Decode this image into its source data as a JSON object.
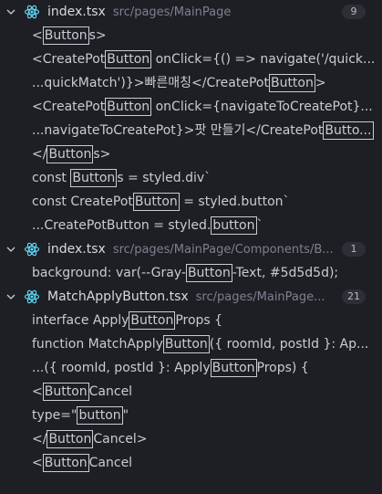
{
  "groups": [
    {
      "file": "index.tsx",
      "path": "src/pages/MainPage",
      "count": "9",
      "matches": [
        [
          "<",
          "Button",
          "s>"
        ],
        [
          "<CreatePot",
          "Button",
          " onClick={() => navigate('/quick..."
        ],
        [
          "...quickMatch')}>빠른매칭</CreatePot",
          "Button",
          ">"
        ],
        [
          "<CreatePot",
          "Button",
          " onClick={navigateToCreatePot}..."
        ],
        [
          "...navigateToCreatePot}>팟 만들기</CreatePot",
          "Butto...",
          ""
        ],
        [
          "</",
          "Button",
          "s>"
        ],
        [
          "const ",
          "Button",
          "s = styled.div`"
        ],
        [
          "const CreatePot",
          "Button",
          " = styled.button`"
        ],
        [
          "...CreatePotButton = styled.",
          "button",
          "`"
        ]
      ]
    },
    {
      "file": "index.tsx",
      "path": "src/pages/MainPage/Components/B...",
      "count": "1",
      "matches": [
        [
          "background: var(--Gray-",
          "Button",
          "-Text, #5d5d5d);"
        ]
      ]
    },
    {
      "file": "MatchApplyButton.tsx",
      "path": "src/pages/MainPage...",
      "count": "21",
      "matches": [
        [
          "interface Apply",
          "Button",
          "Props {"
        ],
        [
          "function MatchApply",
          "Button",
          "({ roomId, postId }: Ap..."
        ],
        [
          "...({ roomId, postId }: Apply",
          "Button",
          "Props) {"
        ],
        [
          "<",
          "Button",
          "Cancel"
        ],
        [
          "type=\"",
          "button",
          "\""
        ],
        [
          "</",
          "Button",
          "Cancel>"
        ],
        [
          "<",
          "Button",
          "Cancel"
        ]
      ]
    }
  ],
  "colors": {
    "background": "#1e1f24",
    "react_icon": "#61dafb",
    "text": "#c9ccd4",
    "path": "#7c8190",
    "badge_bg": "#2d2f37"
  },
  "icons": {
    "expand": "chevron-down-icon",
    "file": "react-icon"
  }
}
